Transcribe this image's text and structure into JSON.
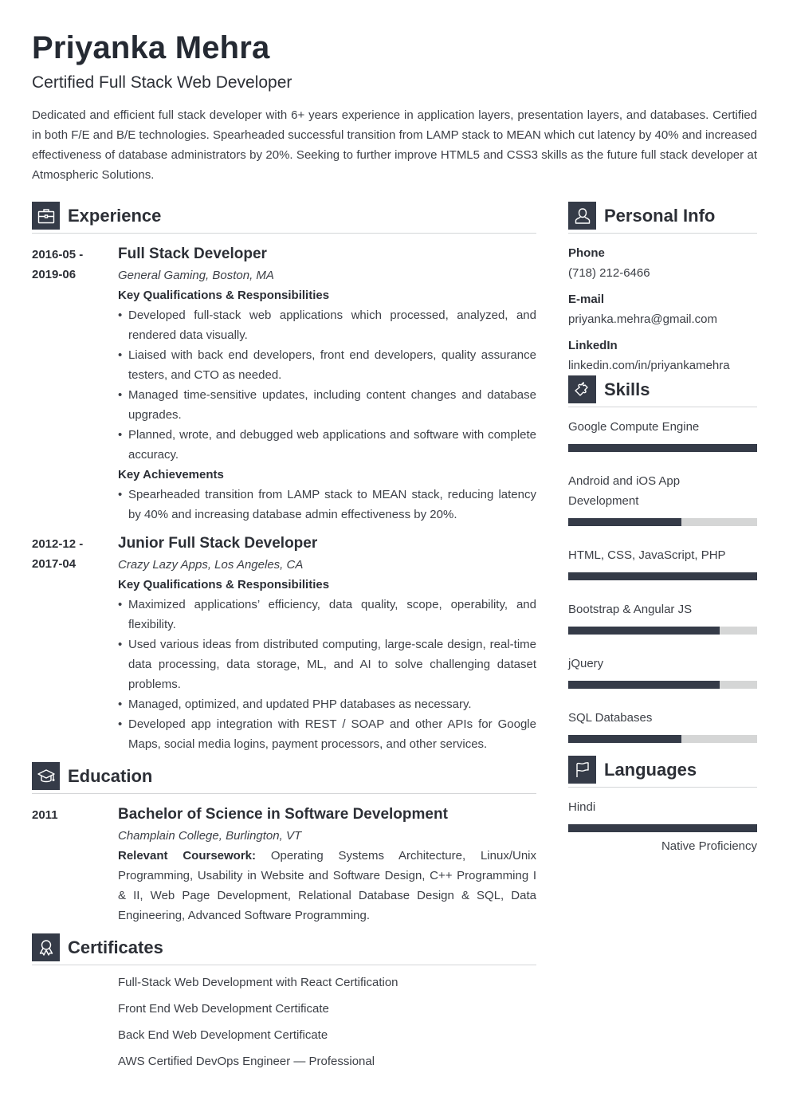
{
  "header": {
    "name": "Priyanka Mehra",
    "title": "Certified Full Stack Web Developer",
    "summary": "Dedicated and efficient full stack developer with 6+ years experience in application layers, presentation layers, and databases. Certified in both F/E and B/E technologies. Spearheaded successful transition from LAMP stack to MEAN which cut latency by 40% and increased effectiveness of database administrators by 20%. Seeking to further improve HTML5 and CSS3 skills as the future full stack developer at Atmospheric Solutions."
  },
  "experience": {
    "heading": "Experience",
    "icon": "briefcase-icon",
    "entries": [
      {
        "date_start": "2016-05 -",
        "date_end": "2019-06",
        "title": "Full Stack Developer",
        "org": "General Gaming, Boston, MA",
        "qual_heading": "Key Qualifications & Responsibilities",
        "qualifications": [
          "Developed full-stack web applications which processed, analyzed, and rendered data visually.",
          "Liaised with back end developers, front end developers, quality assurance testers, and CTO as needed.",
          "Managed time-sensitive updates, including content changes and database upgrades.",
          "Planned, wrote, and debugged web applications and software with complete accuracy."
        ],
        "ach_heading": "Key Achievements",
        "achievements": [
          "Spearheaded transition from LAMP stack to MEAN stack, reducing latency by 40% and increasing database admin effectiveness by 20%."
        ]
      },
      {
        "date_start": "2012-12 -",
        "date_end": "2017-04",
        "title": "Junior Full Stack Developer",
        "org": "Crazy Lazy Apps, Los Angeles, CA",
        "qual_heading": "Key Qualifications & Responsibilities",
        "qualifications": [
          "Maximized applications’ efficiency, data quality, scope, operability, and flexibility.",
          "Used various ideas from distributed computing, large-scale design, real-time data processing, data storage, ML, and AI to solve challenging dataset problems.",
          "Managed, optimized, and updated PHP databases as necessary.",
          "Developed app integration with REST / SOAP and other APIs for Google Maps, social media logins, payment processors, and other services."
        ]
      }
    ]
  },
  "education": {
    "heading": "Education",
    "icon": "graduation-cap-icon",
    "entries": [
      {
        "date": "2011",
        "degree": "Bachelor of Science in Software Development",
        "school": "Champlain College, Burlington, VT",
        "coursework_label": "Relevant Coursework:",
        "coursework": "Operating Systems Architecture, Linux/Unix Programming, Usability in Website and Software Design, C++ Programming I & II, Web Page Development, Relational Database Design & SQL, Data Engineering, Advanced Software Programming."
      }
    ]
  },
  "certificates": {
    "heading": "Certificates",
    "icon": "award-ribbon-icon",
    "items": [
      "Full-Stack Web Development with React Certification",
      "Front End Web Development Certificate",
      "Back End Web Development Certificate",
      "AWS Certified DevOps Engineer — Professional"
    ]
  },
  "personal_info": {
    "heading": "Personal Info",
    "icon": "user-icon",
    "fields": [
      {
        "label": "Phone",
        "value": "(718) 212-6466"
      },
      {
        "label": "E-mail",
        "value": "priyanka.mehra@gmail.com"
      },
      {
        "label": "LinkedIn",
        "value": "linkedin.com/in/priyankamehra"
      }
    ]
  },
  "skills": {
    "heading": "Skills",
    "icon": "puzzle-piece-icon",
    "items": [
      {
        "name": "Google Compute Engine",
        "level": 1.0
      },
      {
        "name": "Android and iOS App Development",
        "level": 0.6
      },
      {
        "name": "HTML, CSS, JavaScript, PHP",
        "level": 1.0
      },
      {
        "name": "Bootstrap & Angular JS",
        "level": 0.8
      },
      {
        "name": "jQuery",
        "level": 0.8
      },
      {
        "name": "SQL Databases",
        "level": 0.6
      }
    ]
  },
  "languages": {
    "heading": "Languages",
    "icon": "flag-icon",
    "items": [
      {
        "name": "Hindi",
        "level": 1.0,
        "proficiency": "Native Proficiency"
      }
    ]
  },
  "colors": {
    "accent": "#353b48",
    "bar_track": "#d5d6d6",
    "divider": "#d4d6d8",
    "text": "#2c2f36"
  }
}
